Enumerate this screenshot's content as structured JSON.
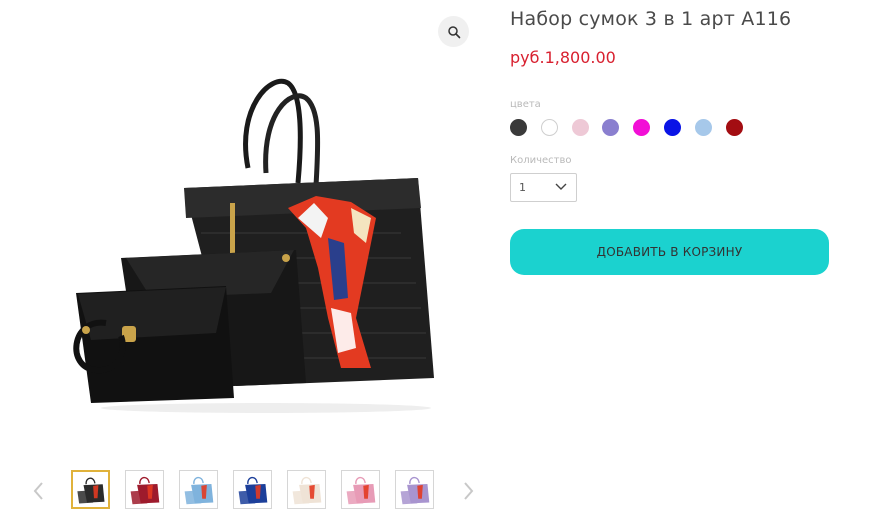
{
  "product": {
    "title": "Набор сумок 3 в 1 арт А116",
    "price": "руб.1,800.00"
  },
  "options": {
    "colors_label": "цвета",
    "colors": [
      "#3a3a3a",
      "#ffffff",
      "#eec9d6",
      "#8a7fcf",
      "#f20fd6",
      "#0a14e6",
      "#a6c8ea",
      "#a30d12"
    ],
    "quantity_label": "Количество",
    "quantity_value": "1"
  },
  "cart": {
    "add_label": "ДОБАВИТЬ В КОРЗИНУ"
  },
  "gallery": {
    "zoom_icon": "magnifier-icon",
    "thumbnails": [
      {
        "color": "#2b2b2b",
        "active": true
      },
      {
        "color": "#9e1b2d",
        "active": false
      },
      {
        "color": "#7fb3dd",
        "active": false
      },
      {
        "color": "#1c3f9a",
        "active": false
      },
      {
        "color": "#efe3d6",
        "active": false
      },
      {
        "color": "#e79bb6",
        "active": false
      },
      {
        "color": "#a894cf",
        "active": false
      }
    ]
  },
  "colors": {
    "accent": "#1bd2cf",
    "price": "#d8202f",
    "active_thumb_border": "#e0b23b"
  }
}
